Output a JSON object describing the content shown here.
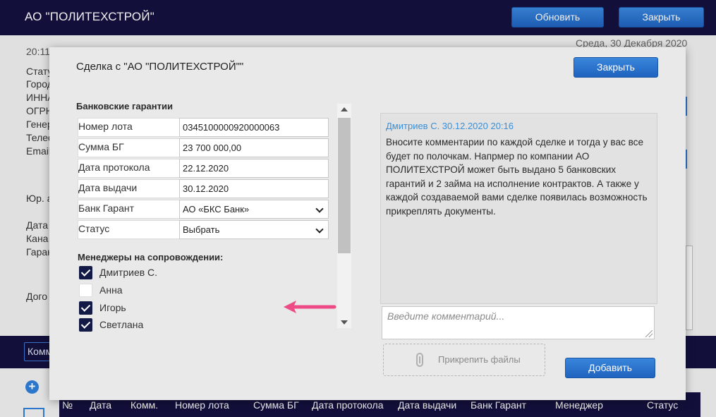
{
  "app": {
    "company": "АО \"ПОЛИТЕХСТРОЙ\"",
    "refresh_label": "Обновить",
    "close_label": "Закрыть"
  },
  "background": {
    "time": "20:11",
    "date": "Среда, 30 Декабря 2020",
    "labels_1": [
      "Стату",
      "Город",
      "ИННА",
      "ОГРН",
      "Генер",
      "Телеф",
      "Email"
    ],
    "label_jur": "Юр. а",
    "labels_2": [
      "Дата",
      "Кана",
      "Гаран"
    ],
    "label_dogo": "Дого",
    "comm_button": "Комм"
  },
  "table": {
    "headers": [
      "№",
      "Дата",
      "Комм.",
      "Номер лота",
      "Сумма БГ",
      "Дата протокола",
      "Дата выдачи",
      "Банк Гарант",
      "Менеджер",
      "Статус"
    ]
  },
  "modal": {
    "title": "Сделка с \"АО \"ПОЛИТЕХСТРОЙ\"\"",
    "close_label": "Закрыть",
    "section_title": "Банковские гарантии",
    "fields": [
      {
        "label": "Номер лота",
        "value": "0345100000920000063"
      },
      {
        "label": "Сумма БГ",
        "value": "23 700 000,00"
      },
      {
        "label": "Дата протокола",
        "value": "22.12.2020"
      },
      {
        "label": "Дата выдачи",
        "value": "30.12.2020"
      },
      {
        "label": "Банк Гарант",
        "value": "АО «БКС Банк»"
      },
      {
        "label": "Статус",
        "value": "Выбрать"
      }
    ],
    "managers_title": "Менеджеры на сопровождении:",
    "managers": [
      {
        "name": "Дмитриев С.",
        "checked": true
      },
      {
        "name": "Анна",
        "checked": false
      },
      {
        "name": "Игорь",
        "checked": true
      },
      {
        "name": "Светлана",
        "checked": true
      }
    ],
    "comment": {
      "author": "Дмитриев С. 30.12.2020 20:16",
      "text": "Вносите комментарии по каждой сделке и тогда у вас все будет по полочкам. Напрмер по компании АО ПОЛИТЕХСТРОЙ может быть выдано 5 банковских гарантий и 2 займа на исполнение контрактов. А также у каждой создаваемой вами сделке появилась возможность прикреплять документы."
    },
    "comment_placeholder": "Введите комментарий...",
    "attach_label": "Прикрепить файлы",
    "add_label": "Добавить"
  },
  "colors": {
    "navbar": "#14123f",
    "button": "#2a74d2",
    "checkbox": "#131a45",
    "comment_author": "#3a8fd8",
    "arrow": "#ee4a86"
  }
}
